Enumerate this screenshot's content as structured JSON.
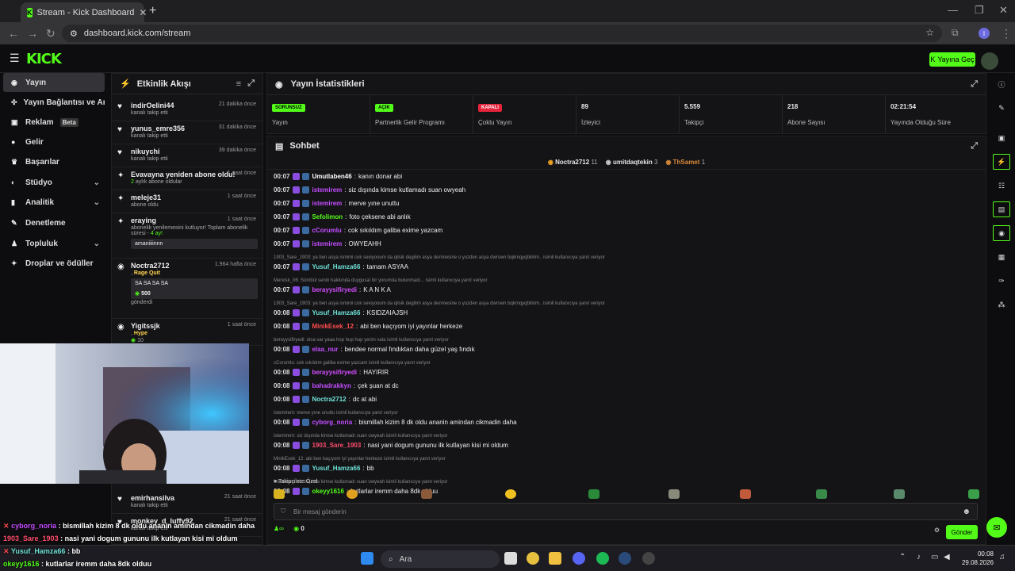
{
  "browser": {
    "tab_title": "Stream - Kick Dashboard",
    "url": "dashboard.kick.com/stream",
    "profile_initial": "I"
  },
  "header": {
    "logo": "KICK",
    "go_live": "Yayına Geç"
  },
  "sidebar": {
    "items": [
      {
        "label": "Yayın",
        "icon": "stream-icon"
      },
      {
        "label": "Yayın Bağlantısı ve Anahtarı",
        "icon": "link-icon"
      },
      {
        "label": "Reklam",
        "badge": "Beta",
        "icon": "ads-icon"
      },
      {
        "label": "Gelir",
        "icon": "revenue-icon"
      },
      {
        "label": "Başarılar",
        "icon": "trophy-icon"
      },
      {
        "label": "Stüdyo",
        "icon": "studio-icon"
      },
      {
        "label": "Analitik",
        "icon": "analytics-icon"
      },
      {
        "label": "Denetleme",
        "icon": "moderation-icon"
      },
      {
        "label": "Topluluk",
        "icon": "community-icon"
      },
      {
        "label": "Droplar ve ödüller",
        "icon": "drops-icon"
      }
    ]
  },
  "feed": {
    "title": "Etkinlik Akışı",
    "items": [
      {
        "user": "indirOelini44",
        "time": "21 dakika önce",
        "sub": "kanalı takip etti"
      },
      {
        "user": "yunus_emre356",
        "time": "31 dakika önce",
        "sub": "kanalı takip etti"
      },
      {
        "user": "nikuychi",
        "time": "39 dakika önce",
        "sub": "kanalı takip etti"
      },
      {
        "user": "Evavayna yeniden abone oldu!",
        "time": "1 saat önce",
        "sub_count": "2",
        "sub_rest": "aylık abone oldular"
      },
      {
        "user": "meleje31",
        "time": "1 saat önce",
        "sub": "abone oldu"
      },
      {
        "user": "eraying",
        "time": "1 saat önce",
        "sub": "abonelik yenilemesini kutluyor! Toplam abonelik süresi -",
        "months": "4 ay!",
        "msg": "amaniiiinnn"
      },
      {
        "user": "Noctra2712",
        "time": "1.964 hafta önce",
        "reward": "Rage Quit",
        "msg": "SA SA SA SA",
        "amount": "500",
        "sub": "gönderdi"
      },
      {
        "user": "Yigitssjk",
        "time": "1 saat önce",
        "reward": "Hype",
        "amount": "10"
      },
      {
        "user": "emirhansilva",
        "time": "21 saat önce",
        "sub": "kanalı takip etti"
      },
      {
        "user": "monkey_d_luffy92",
        "time": "21 saat önce",
        "sub": "kanalı takip etti"
      }
    ]
  },
  "stats": {
    "title": "Yayın İstatistikleri",
    "items": [
      {
        "badge": "SORUNSUZ",
        "label": "Yayın",
        "color": "#53fc18"
      },
      {
        "badge": "AÇIK",
        "label": "Partnerlik Gelir Programı",
        "color": "#53fc18"
      },
      {
        "badge": "KAPALI",
        "label": "Çoklu Yayın",
        "color": "#e5243b"
      },
      {
        "value": "89",
        "label": "İzleyici"
      },
      {
        "value": "5.559",
        "label": "Takipçi"
      },
      {
        "value": "218",
        "label": "Abone Sayısı"
      },
      {
        "value": "02:21:54",
        "label": "Yayında Olduğu Süre"
      }
    ]
  },
  "chat": {
    "title": "Sohbet",
    "top": [
      {
        "name": "Noctra2712",
        "n": "11",
        "color": "#f5a623"
      },
      {
        "name": "umitdaqtekin",
        "n": "3",
        "color": "#cccccc"
      },
      {
        "name": "ThSamet",
        "n": "1",
        "color": "#d98a3a"
      }
    ],
    "messages": [
      {
        "time": "00:07",
        "user": "Umutlaben46",
        "color": "#ffffff",
        "text": "kanın donar abi"
      },
      {
        "time": "00:07",
        "user": "istemirem",
        "color": "#c44dff",
        "text": "siz dışında kimse kutlamadı suan owyeah"
      },
      {
        "time": "00:07",
        "user": "istemirem",
        "color": "#c44dff",
        "text": "merve yıne unuttu"
      },
      {
        "time": "00:07",
        "user": "Sefolimon",
        "color": "#53fc18",
        "text": "foto çeksene abi anlık"
      },
      {
        "time": "00:07",
        "user": "cCorumlu",
        "color": "#c44dff",
        "text": "cok sıkıldım galiba exime yazcam"
      },
      {
        "time": "00:07",
        "user": "istemirem",
        "color": "#c44dff",
        "text": "OWYEAHH"
      },
      {
        "reply": "1903_Sare_1903: ya ben asya ismimi cok seviyooum da qilsik degilim asya denmesine o yuzden asya dwrswn bqkmqyqbilirim.. isimli kullanıcıya yanıt veriyor"
      },
      {
        "time": "00:07",
        "user": "Yusuf_Hamza66",
        "color": "#6fe3d8",
        "text": "tamam ASYAA"
      },
      {
        "reply": "Mervisk_06: Sümbül senin hakkında duygusal bir yorumda bulunmadı... isimli kullanıcıya yanıt veriyor"
      },
      {
        "time": "00:07",
        "user": "berayysifiryedi",
        "color": "#d44dff",
        "text": "K A N K A"
      },
      {
        "reply": "1903_Sare_1903: ya ben asya ismimi cok seviyooum da qilsik degilim asya denmesine o yuzden asya dwrswn bqkmqyqbilirim.. isimli kullanıcıya yanıt veriyor"
      },
      {
        "time": "00:08",
        "user": "Yusuf_Hamza66",
        "color": "#6fe3d8",
        "text": "KSIDZAIAJSH"
      },
      {
        "time": "00:08",
        "user": "MinikEsek_12",
        "color": "#ff4d4d",
        "text": "abi ben kaçıyom iyi yayınlar herkeze"
      },
      {
        "reply": "berayysifiryedi: olsa var yaaa hop hup hup yerim vala isimli kullanıcıya yanıt veriyor"
      },
      {
        "time": "00:08",
        "user": "elaa_nur",
        "color": "#c44dff",
        "text": "bendee normal fındıktan daha güzel yaş fındık"
      },
      {
        "reply": "cCorumlu: cok sıkıldım galiba exime yazcam isimli kullanıcıya yanıt veriyor"
      },
      {
        "time": "00:08",
        "user": "berayysifiryedi",
        "color": "#d44dff",
        "text": "HAYIRIR"
      },
      {
        "time": "00:08",
        "user": "bahadrakkyn",
        "color": "#c44dff",
        "text": "çek şuan at dc"
      },
      {
        "time": "00:08",
        "user": "Noctra2712",
        "color": "#6fe3d8",
        "text": "dc at abi"
      },
      {
        "reply": "istemirem: merve yıne unuttu isimli kullanıcıya yanıt veriyor"
      },
      {
        "time": "00:08",
        "user": "cyborg_noria",
        "color": "#c44dff",
        "text": "bismillah kizim 8 dk oldu ananin amindan cikmadin daha"
      },
      {
        "reply": "istemirem: siz dışında kimse kutlamadı suan owyeah isimli kullanıcıya yanıt veriyor"
      },
      {
        "time": "00:08",
        "user": "1903_Sare_1903",
        "color": "#ff4d6d",
        "text": "nasi yani dogum gununu ilk kutlayan kisi mi oldum"
      },
      {
        "reply": "MinikEsek_12: abi ben kaçıyom iyi yayınlar herkeze isimli kullanıcıya yanıt veriyor"
      },
      {
        "time": "00:08",
        "user": "Yusuf_Hamza66",
        "color": "#6fe3d8",
        "text": "bb"
      },
      {
        "reply": "istemirem: siz dışında kimse kutlamadı suan owyeah isimli kullanıcıya yanıt veriyor"
      },
      {
        "time": "00:08",
        "user": "okeyy1616",
        "color": "#53fc18",
        "text": "kutlarlar iremm daha 8dk olduu"
      }
    ],
    "subs_label": "Takipçilere Özel",
    "placeholder": "Bir mesaj gönderin",
    "viewers_count": "0",
    "send": "Gönder"
  },
  "overlay": [
    {
      "user": "cyborg_noria",
      "color": "#c44dff",
      "text": "bismillah kizim 8 dk oldu ananin amindan cikmadin daha"
    },
    {
      "user": "1903_Sare_1903",
      "color": "#ff4d6d",
      "text": "nasi yani dogum gununu ilk kutlayan kisi mi oldum"
    },
    {
      "user": "Yusuf_Hamza66",
      "color": "#6fe3d8",
      "text": "bb"
    },
    {
      "user": "okeyy1616",
      "color": "#53fc18",
      "text": "kutlarlar iremm daha 8dk olduu"
    }
  ],
  "taskbar": {
    "search": "Ara",
    "time": "00:08",
    "date": "29.08.2026"
  }
}
